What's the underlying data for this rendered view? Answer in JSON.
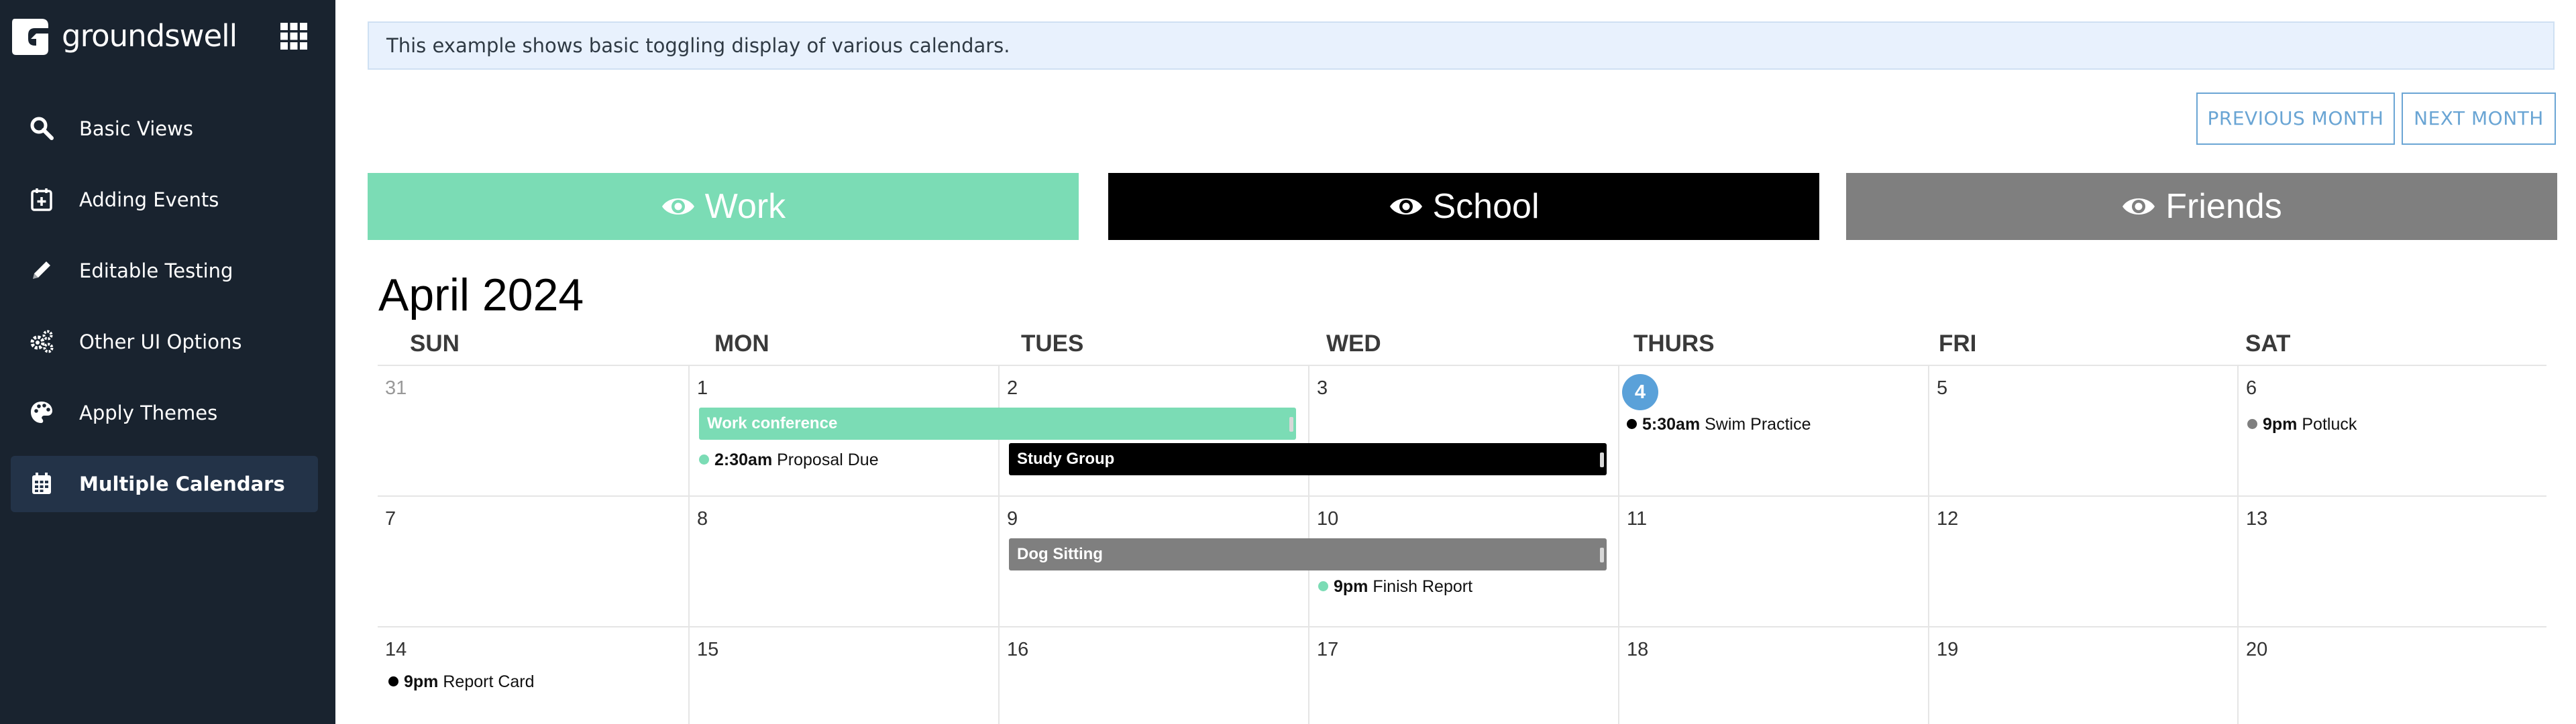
{
  "brand": {
    "name": "groundswell"
  },
  "nav": [
    {
      "label": "Basic Views",
      "icon": "search-icon"
    },
    {
      "label": "Adding Events",
      "icon": "calendar-plus-icon"
    },
    {
      "label": "Editable Testing",
      "icon": "pencil-icon"
    },
    {
      "label": "Other UI Options",
      "icon": "gears-icon"
    },
    {
      "label": "Apply Themes",
      "icon": "palette-icon"
    },
    {
      "label": "Multiple Calendars",
      "icon": "calendar-grid-icon",
      "active": true
    }
  ],
  "info_text": "This example shows basic toggling display of various calendars.",
  "buttons": {
    "prev": "PREVIOUS MONTH",
    "next": "NEXT MONTH"
  },
  "calendars": [
    {
      "label": "Work",
      "color": "#7bdcb5"
    },
    {
      "label": "School",
      "color": "#000000"
    },
    {
      "label": "Friends",
      "color": "#7f7f7f"
    }
  ],
  "month_title": "April 2024",
  "weekdays": [
    "SUN",
    "MON",
    "TUES",
    "WED",
    "THURS",
    "FRI",
    "SAT"
  ],
  "weeks": [
    [
      "31",
      "1",
      "2",
      "3",
      "4",
      "5",
      "6"
    ],
    [
      "7",
      "8",
      "9",
      "10",
      "11",
      "12",
      "13"
    ],
    [
      "14",
      "15",
      "16",
      "17",
      "18",
      "19",
      "20"
    ]
  ],
  "today": "4",
  "events": {
    "work_conference": "Work conference",
    "study_group": "Study Group",
    "dog_sitting": "Dog Sitting",
    "proposal": {
      "time": "2:30am",
      "title": "Proposal Due"
    },
    "swim": {
      "time": "5:30am",
      "title": "Swim Practice"
    },
    "potluck": {
      "time": "9pm",
      "title": "Potluck"
    },
    "finish_report": {
      "time": "9pm",
      "title": "Finish Report"
    },
    "report_card": {
      "time": "9pm",
      "title": "Report Card"
    }
  },
  "colors": {
    "work": "#7bdcb5",
    "school": "#000000",
    "friends": "#7f7f7f",
    "today": "#5aa1d9",
    "sidebar": "#19232f"
  }
}
